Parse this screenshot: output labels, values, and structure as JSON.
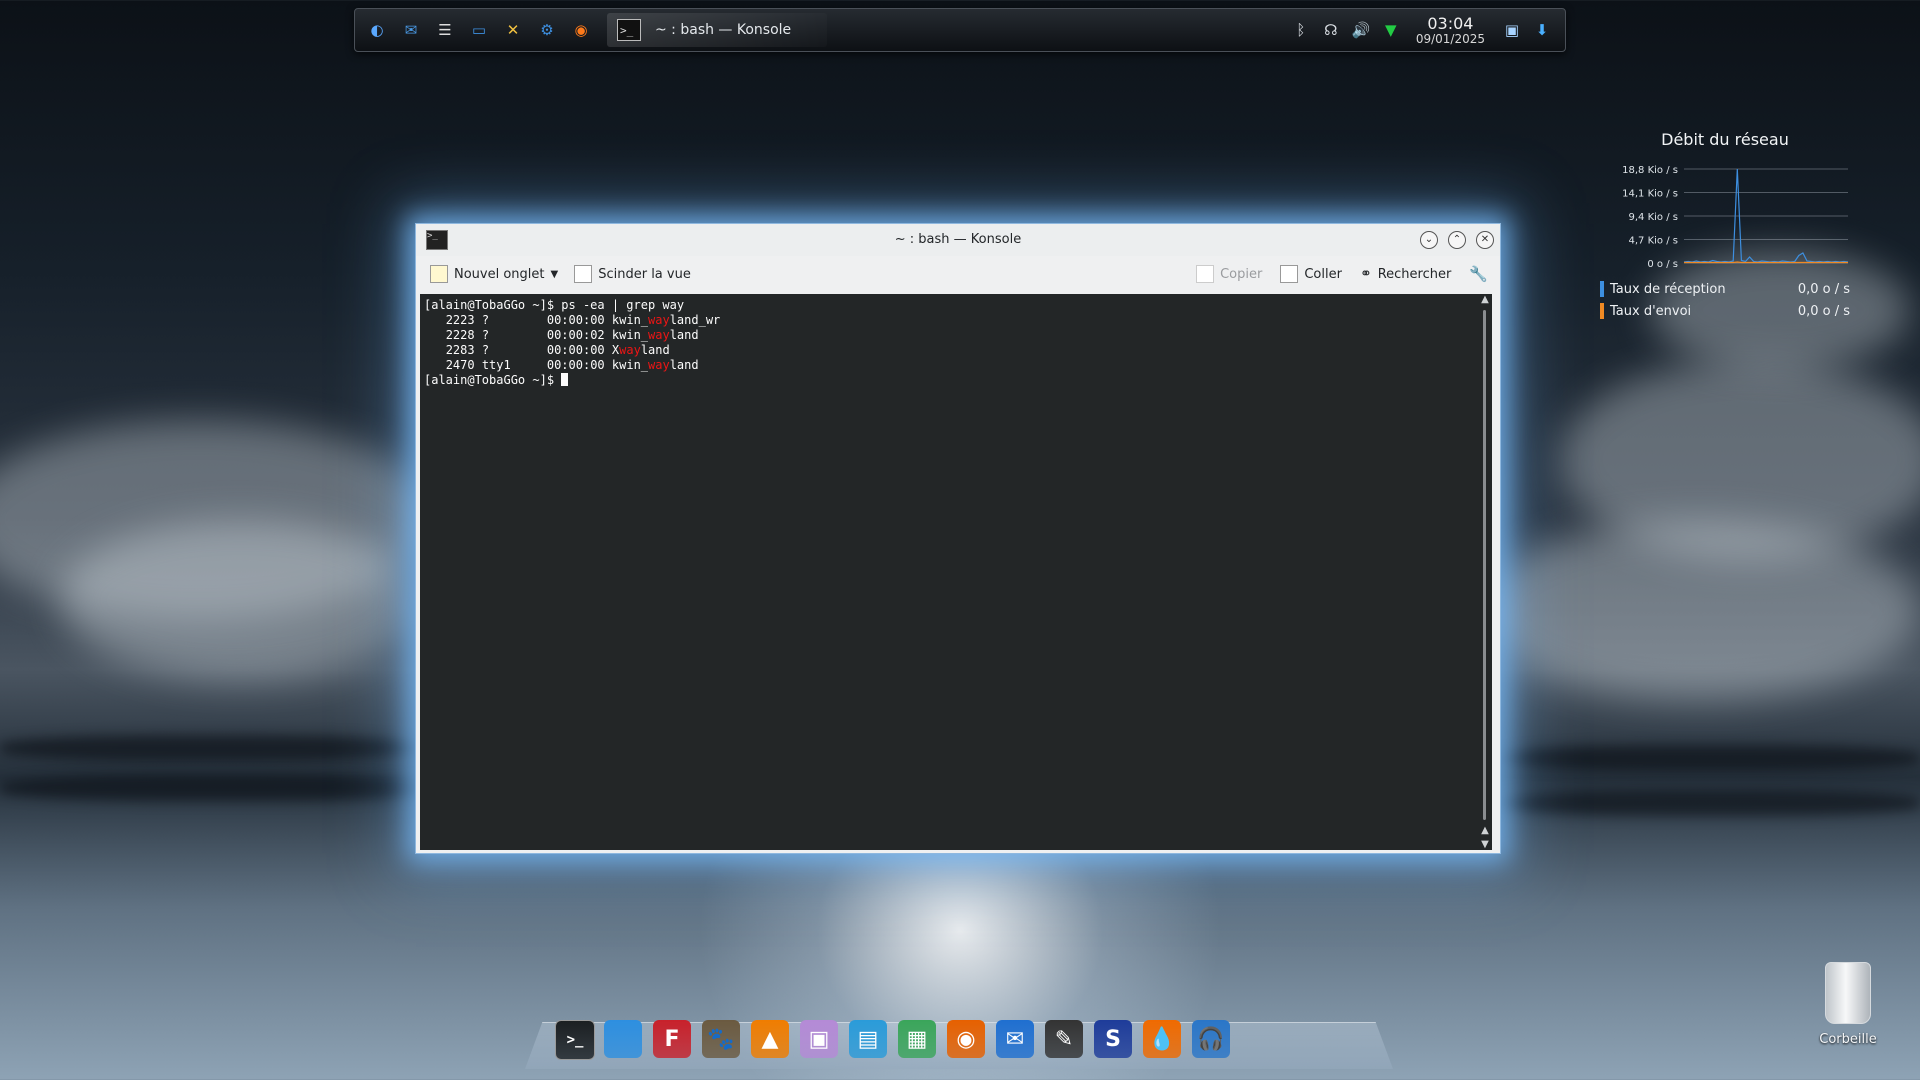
{
  "top_panel": {
    "launcher_icons": [
      "app-menu-icon",
      "mail-icon",
      "task-list-icon",
      "file-manager-icon",
      "settings-tools-icon",
      "system-gear-icon",
      "firefox-icon"
    ],
    "task": {
      "icon": ">_",
      "label": "~ : bash — Konsole"
    },
    "tray_icons": [
      "bluetooth-icon",
      "kde-connect-icon",
      "volume-icon",
      "network-icon"
    ],
    "clock": {
      "time": "03:04",
      "date": "09/01/2025"
    },
    "right_icons": [
      "show-desktop-icon",
      "updates-icon"
    ]
  },
  "konsole": {
    "title": "~ : bash — Konsole",
    "toolbar": {
      "new_tab": "Nouvel onglet",
      "split_view": "Scinder la vue",
      "copy": "Copier",
      "paste": "Coller",
      "search": "Rechercher"
    },
    "terminal": {
      "line1": "[alain@TobaGGo ~]$ ps -ea | grep way",
      "processes": [
        {
          "pid": "2223",
          "tty": "?",
          "time": "00:00:00",
          "pre": "kwin_",
          "match": "way",
          "post": "land_wr"
        },
        {
          "pid": "2228",
          "tty": "?",
          "time": "00:00:02",
          "pre": "kwin_",
          "match": "way",
          "post": "land"
        },
        {
          "pid": "2283",
          "tty": "?",
          "time": "00:00:00",
          "pre": "X",
          "match": "way",
          "post": "land"
        },
        {
          "pid": "2470",
          "tty": "tty1",
          "time": "00:00:00",
          "pre": "kwin_",
          "match": "way",
          "post": "land"
        }
      ],
      "prompt": "[alain@TobaGGo ~]$ "
    }
  },
  "network_widget": {
    "title": "Débit du réseau",
    "legend": [
      {
        "label": "Taux de réception",
        "value": "0,0 o / s",
        "color": "#3d8fe0"
      },
      {
        "label": "Taux d'envoi",
        "value": "0,0 o / s",
        "color": "#f08a24"
      }
    ]
  },
  "chart_data": {
    "type": "line",
    "ytick_labels": [
      "18,8 Kio / s",
      "14,1 Kio / s",
      "9,4 Kio / s",
      "4,7 Kio / s",
      "0 o / s"
    ],
    "ylim": [
      0,
      18.8
    ],
    "x": [
      0,
      1,
      2,
      3,
      4,
      5,
      6,
      7,
      8,
      9,
      10,
      11,
      12,
      13,
      14,
      15,
      16,
      17,
      18,
      19,
      20,
      21,
      22,
      23,
      24,
      25,
      26,
      27,
      28,
      29,
      30,
      31,
      32,
      33,
      34,
      35,
      36,
      37,
      38,
      39,
      40
    ],
    "series": [
      {
        "values": [
          0.2,
          0.3,
          0.2,
          0.4,
          0.2,
          0.3,
          0.2,
          0.5,
          0.3,
          0.2,
          0.3,
          0.2,
          0.4,
          18.8,
          0.5,
          0.3,
          1.2,
          0.3,
          0.2,
          0.4,
          0.3,
          0.2,
          0.3,
          0.2,
          0.4,
          0.3,
          0.2,
          0.3,
          1.5,
          2.0,
          0.4,
          0.3,
          0.2,
          0.3,
          0.2,
          0.3,
          0.2,
          0.3,
          0.2,
          0.3,
          0.2
        ]
      },
      {
        "values": [
          0.1,
          0.1,
          0.1,
          0.1,
          0.1,
          0.1,
          0.1,
          0.1,
          0.1,
          0.1,
          0.1,
          0.1,
          0.1,
          0.2,
          0.1,
          0.1,
          0.1,
          0.1,
          0.1,
          0.1,
          0.1,
          0.1,
          0.1,
          0.1,
          0.1,
          0.1,
          0.1,
          0.1,
          0.1,
          0.1,
          0.1,
          0.1,
          0.1,
          0.1,
          0.1,
          0.1,
          0.1,
          0.1,
          0.1,
          0.1,
          0.1
        ]
      }
    ]
  },
  "dock": {
    "icons": [
      {
        "name": "konsole-icon",
        "glyph": ">_",
        "color": "#1b1f22"
      },
      {
        "name": "dolphin-icon",
        "glyph": "",
        "color": "#2d8fe0"
      },
      {
        "name": "filezilla-icon",
        "glyph": "F",
        "color": "#c8212b"
      },
      {
        "name": "gimp-icon",
        "glyph": "🐾",
        "color": "#6b5a40"
      },
      {
        "name": "vlc-icon",
        "glyph": "▲",
        "color": "#f07d00"
      },
      {
        "name": "photo-app-icon",
        "glyph": "▣",
        "color": "#b48ad6"
      },
      {
        "name": "writer-icon",
        "glyph": "▤",
        "color": "#2a9bd9"
      },
      {
        "name": "calc-icon",
        "glyph": "▦",
        "color": "#3aa55a"
      },
      {
        "name": "firefox-dock-icon",
        "glyph": "◉",
        "color": "#e66000"
      },
      {
        "name": "thunderbird-icon",
        "glyph": "✉",
        "color": "#1f6fd0"
      },
      {
        "name": "inkscape-pen-icon",
        "glyph": "✎",
        "color": "#333333"
      },
      {
        "name": "app-s-icon",
        "glyph": "S",
        "color": "#1e3c9a"
      },
      {
        "name": "drop-app-icon",
        "glyph": "💧",
        "color": "#f06a00"
      },
      {
        "name": "headphones-icon",
        "glyph": "🎧",
        "color": "#2a76c8"
      }
    ]
  },
  "desktop": {
    "trash_label": "Corbeille"
  }
}
